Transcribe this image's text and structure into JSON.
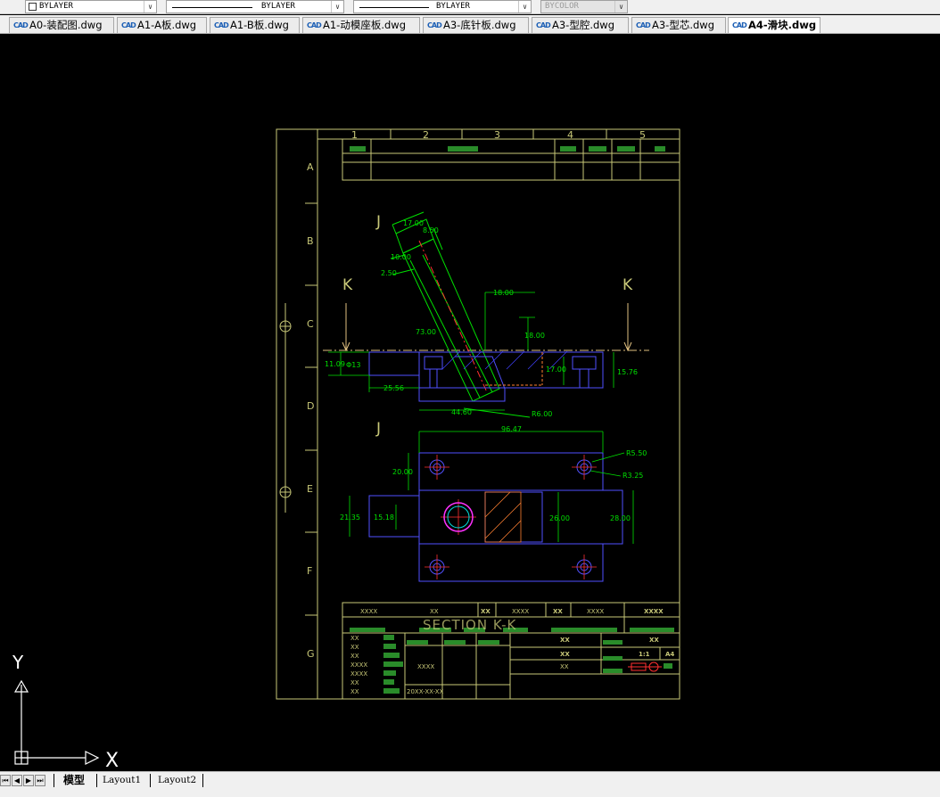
{
  "toolbar": {
    "color_control": "BYLAYER",
    "linetype_control": "BYLAYER",
    "lineweight_control": "BYLAYER",
    "plotstyle_control": "BYCOLOR"
  },
  "tabs": [
    {
      "icon": "CAD",
      "label": "A0-装配图.dwg"
    },
    {
      "icon": "CAD",
      "label": "A1-A板.dwg"
    },
    {
      "icon": "CAD",
      "label": "A1-B板.dwg"
    },
    {
      "icon": "CAD",
      "label": "A1-动模座板.dwg"
    },
    {
      "icon": "CAD",
      "label": "A3-底针板.dwg"
    },
    {
      "icon": "CAD",
      "label": "A3-型腔.dwg"
    },
    {
      "icon": "CAD",
      "label": "A3-型芯.dwg"
    },
    {
      "icon": "CAD",
      "label": "A4-滑块.dwg"
    }
  ],
  "active_tab_index": 7,
  "drawing": {
    "grid_columns": [
      "1",
      "2",
      "3",
      "4",
      "5"
    ],
    "grid_rows": [
      "A",
      "B",
      "C",
      "D",
      "E",
      "F",
      "G"
    ],
    "view_labels": {
      "j_top": "J",
      "k_left": "K",
      "k_right": "K",
      "j_bottom": "J"
    },
    "dims": {
      "d1700a": "17.00",
      "d850": "8.50",
      "d1000": "10.00",
      "d250": "2.50",
      "d7300": "73.00",
      "d1800a": "18.00",
      "d1800b": "18.00",
      "d1109": "11.09",
      "dphi13": "Φ13",
      "d1700b": "17.00",
      "d1576": "15.76",
      "d2556": "25.56",
      "d4460": "44.60",
      "dr600": "R6.00",
      "d9647": "96.47",
      "dr550": "R5.50",
      "dr325": "R3.25",
      "d2000": "20.00",
      "d2135": "21.35",
      "d1518": "15.18",
      "d2600": "26.00",
      "d2800": "28.00"
    },
    "title_block": {
      "section_label": "SECTION K-K",
      "date": "20XX-XX-XX",
      "cell_x4": "XXXX",
      "cell_x2": "XX",
      "cell_bold": "XX",
      "scale": "A4",
      "ratio": "1:1"
    }
  },
  "ucs": {
    "y_label": "Y",
    "x_label": "X"
  },
  "layout_tabs": [
    "模型",
    "Layout1",
    "Layout2"
  ],
  "active_layout_index": 0,
  "colors": {
    "frame": "#c8c878",
    "dim": "#00e000",
    "outline": "#5050ff",
    "center": "#ff3030",
    "hidden": "#ff8030",
    "section": "#4040ff",
    "fill": "#2a8c2a"
  }
}
